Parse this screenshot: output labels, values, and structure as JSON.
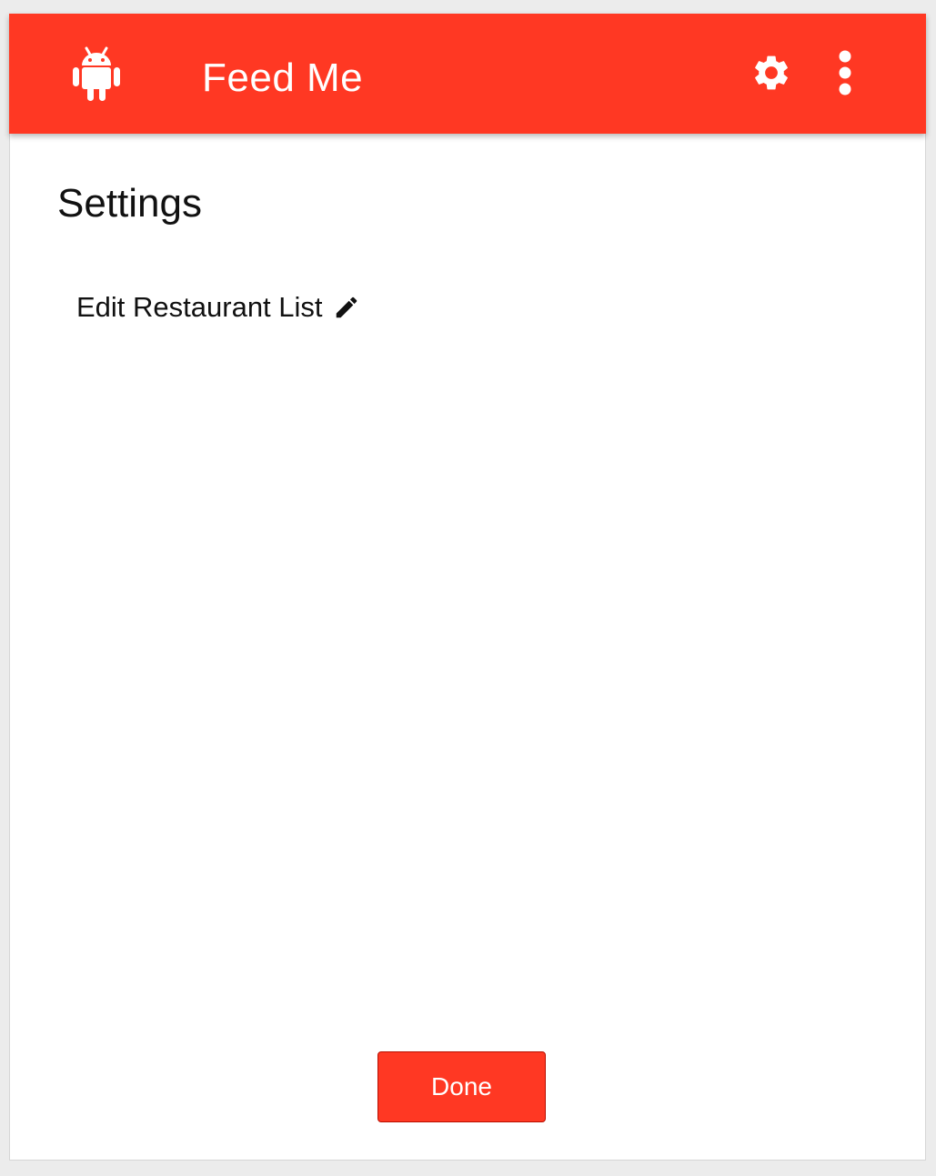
{
  "app_bar": {
    "title": "Feed Me",
    "icons": {
      "app": "android-icon",
      "settings": "gear-icon",
      "menu": "more-vert-icon"
    },
    "color": "#ff3823"
  },
  "page": {
    "title": "Settings",
    "edit_restaurant_label": "Edit Restaurant List",
    "edit_icon": "pencil-icon"
  },
  "actions": {
    "done_label": "Done"
  },
  "colors": {
    "accent": "#ff3823",
    "background": "#ececec",
    "surface": "#ffffff",
    "text": "#111111"
  }
}
